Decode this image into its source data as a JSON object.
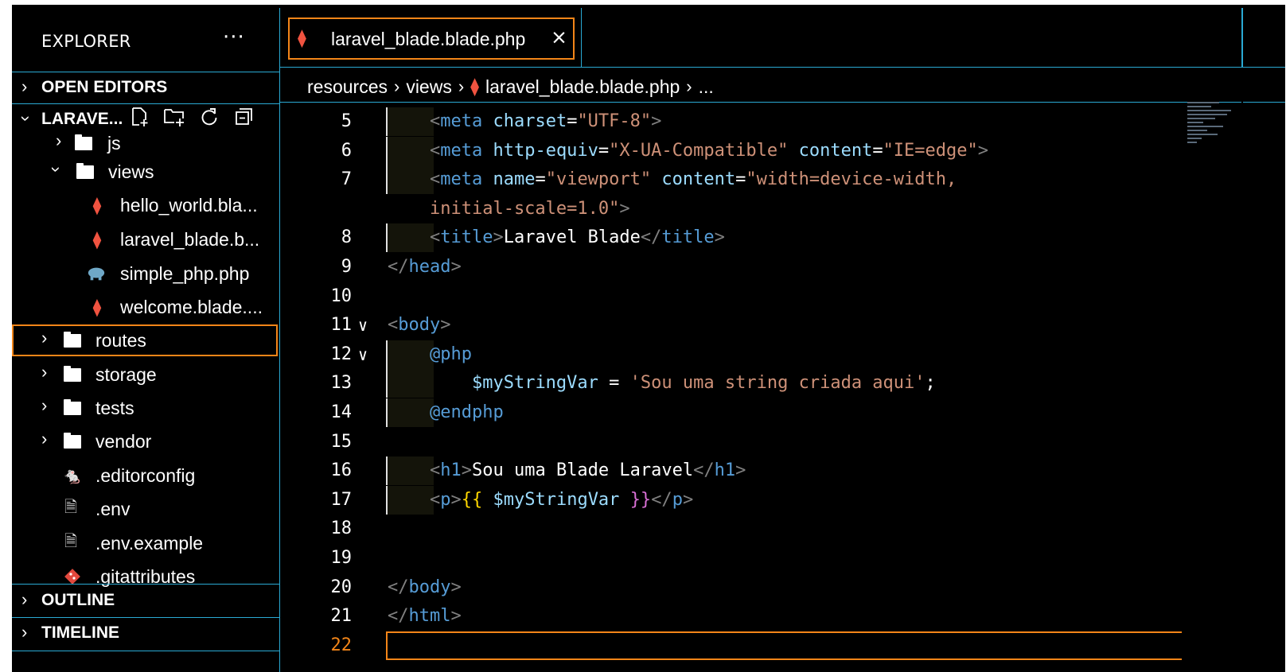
{
  "sidebar": {
    "title": "EXPLORER",
    "more_label": "···",
    "open_editors": "OPEN EDITORS",
    "project": "LARAVE...",
    "tree": [
      {
        "label": "js",
        "indent": 1,
        "type": "folder",
        "expanded": false
      },
      {
        "label": "views",
        "indent": 1,
        "type": "folder",
        "expanded": true
      },
      {
        "label": "hello_world.bla...",
        "indent": 2,
        "type": "laravel"
      },
      {
        "label": "laravel_blade.b...",
        "indent": 2,
        "type": "laravel"
      },
      {
        "label": "simple_php.php",
        "indent": 2,
        "type": "php"
      },
      {
        "label": "welcome.blade....",
        "indent": 2,
        "type": "laravel"
      },
      {
        "label": "routes",
        "indent": 0,
        "type": "folder",
        "expanded": false,
        "selected": true
      },
      {
        "label": "storage",
        "indent": 0,
        "type": "folder",
        "expanded": false
      },
      {
        "label": "tests",
        "indent": 0,
        "type": "folder",
        "expanded": false
      },
      {
        "label": "vendor",
        "indent": 0,
        "type": "folder",
        "expanded": false
      },
      {
        "label": ".editorconfig",
        "indent": 0,
        "type": "editorconfig"
      },
      {
        "label": ".env",
        "indent": 0,
        "type": "file"
      },
      {
        "label": ".env.example",
        "indent": 0,
        "type": "file"
      },
      {
        "label": ".gitattributes",
        "indent": 0,
        "type": "git"
      }
    ],
    "outline": "OUTLINE",
    "timeline": "TIMELINE"
  },
  "editor": {
    "tab_label": "laravel_blade.blade.php",
    "close_icon": "×",
    "breadcrumb": [
      "resources",
      "views",
      "laravel_blade.blade.php",
      "..."
    ],
    "lines": [
      {
        "n": "5",
        "guide": true,
        "parts": [
          [
            "tag",
            "    <"
          ],
          [
            "name",
            "meta"
          ],
          [
            "txt",
            " "
          ],
          [
            "attr",
            "charset"
          ],
          [
            "txt",
            "="
          ],
          [
            "str",
            "\"UTF-8\""
          ],
          [
            "tag",
            ">"
          ]
        ]
      },
      {
        "n": "6",
        "guide": true,
        "parts": [
          [
            "tag",
            "    <"
          ],
          [
            "name",
            "meta"
          ],
          [
            "txt",
            " "
          ],
          [
            "attr",
            "http-equiv"
          ],
          [
            "txt",
            "="
          ],
          [
            "str",
            "\"X-UA-Compatible\""
          ],
          [
            "txt",
            " "
          ],
          [
            "attr",
            "content"
          ],
          [
            "txt",
            "="
          ],
          [
            "str",
            "\"IE=edge\""
          ],
          [
            "tag",
            ">"
          ]
        ]
      },
      {
        "n": "7",
        "guide": true,
        "parts": [
          [
            "tag",
            "    <"
          ],
          [
            "name",
            "meta"
          ],
          [
            "txt",
            " "
          ],
          [
            "attr",
            "name"
          ],
          [
            "txt",
            "="
          ],
          [
            "str",
            "\"viewport\""
          ],
          [
            "txt",
            " "
          ],
          [
            "attr",
            "content"
          ],
          [
            "txt",
            "="
          ],
          [
            "str",
            "\"width=device-width,"
          ]
        ]
      },
      {
        "n": "",
        "guide": false,
        "parts": [
          [
            "str",
            "    initial-scale=1.0\""
          ],
          [
            "tag",
            ">"
          ]
        ]
      },
      {
        "n": "8",
        "guide": true,
        "parts": [
          [
            "tag",
            "    <"
          ],
          [
            "name",
            "title"
          ],
          [
            "tag",
            ">"
          ],
          [
            "txt",
            "Laravel Blade"
          ],
          [
            "tag",
            "</"
          ],
          [
            "name",
            "title"
          ],
          [
            "tag",
            ">"
          ]
        ]
      },
      {
        "n": "9",
        "guide": false,
        "parts": [
          [
            "tag",
            "</"
          ],
          [
            "name",
            "head"
          ],
          [
            "tag",
            ">"
          ]
        ]
      },
      {
        "n": "10",
        "guide": false,
        "parts": []
      },
      {
        "n": "11",
        "fold": true,
        "guide": false,
        "parts": [
          [
            "tag",
            "<"
          ],
          [
            "name",
            "body"
          ],
          [
            "tag",
            ">"
          ]
        ]
      },
      {
        "n": "12",
        "fold": true,
        "guide": true,
        "parts": [
          [
            "name",
            "    @php"
          ]
        ]
      },
      {
        "n": "13",
        "guide": true,
        "parts": [
          [
            "txt",
            "        "
          ],
          [
            "var",
            "$myStringVar"
          ],
          [
            "txt",
            " = "
          ],
          [
            "str",
            "'Sou uma string criada aqui'"
          ],
          [
            "txt",
            ";"
          ]
        ]
      },
      {
        "n": "14",
        "guide": true,
        "parts": [
          [
            "name",
            "    @endphp"
          ]
        ]
      },
      {
        "n": "15",
        "guide": false,
        "parts": []
      },
      {
        "n": "16",
        "guide": true,
        "parts": [
          [
            "tag",
            "    <"
          ],
          [
            "name",
            "h1"
          ],
          [
            "tag",
            ">"
          ],
          [
            "txt",
            "Sou uma Blade Laravel"
          ],
          [
            "tag",
            "</"
          ],
          [
            "name",
            "h1"
          ],
          [
            "tag",
            ">"
          ]
        ]
      },
      {
        "n": "17",
        "guide": true,
        "parts": [
          [
            "tag",
            "    <"
          ],
          [
            "name",
            "p"
          ],
          [
            "tag",
            ">"
          ],
          [
            "brace",
            "{{"
          ],
          [
            "txt",
            " "
          ],
          [
            "var",
            "$myStringVar"
          ],
          [
            "txt",
            " "
          ],
          [
            "brace2",
            "}}"
          ],
          [
            "tag",
            "</"
          ],
          [
            "name",
            "p"
          ],
          [
            "tag",
            ">"
          ]
        ]
      },
      {
        "n": "18",
        "guide": false,
        "parts": []
      },
      {
        "n": "19",
        "guide": false,
        "parts": []
      },
      {
        "n": "20",
        "guide": false,
        "parts": [
          [
            "tag",
            "</"
          ],
          [
            "name",
            "body"
          ],
          [
            "tag",
            ">"
          ]
        ]
      },
      {
        "n": "21",
        "guide": false,
        "parts": [
          [
            "tag",
            "</"
          ],
          [
            "name",
            "html"
          ],
          [
            "tag",
            ">"
          ]
        ]
      },
      {
        "n": "22",
        "active": true,
        "guide": false,
        "parts": []
      }
    ]
  },
  "colors": {
    "accent": "#f38518",
    "border": "#2aaad4",
    "laravel": "#f05340"
  }
}
